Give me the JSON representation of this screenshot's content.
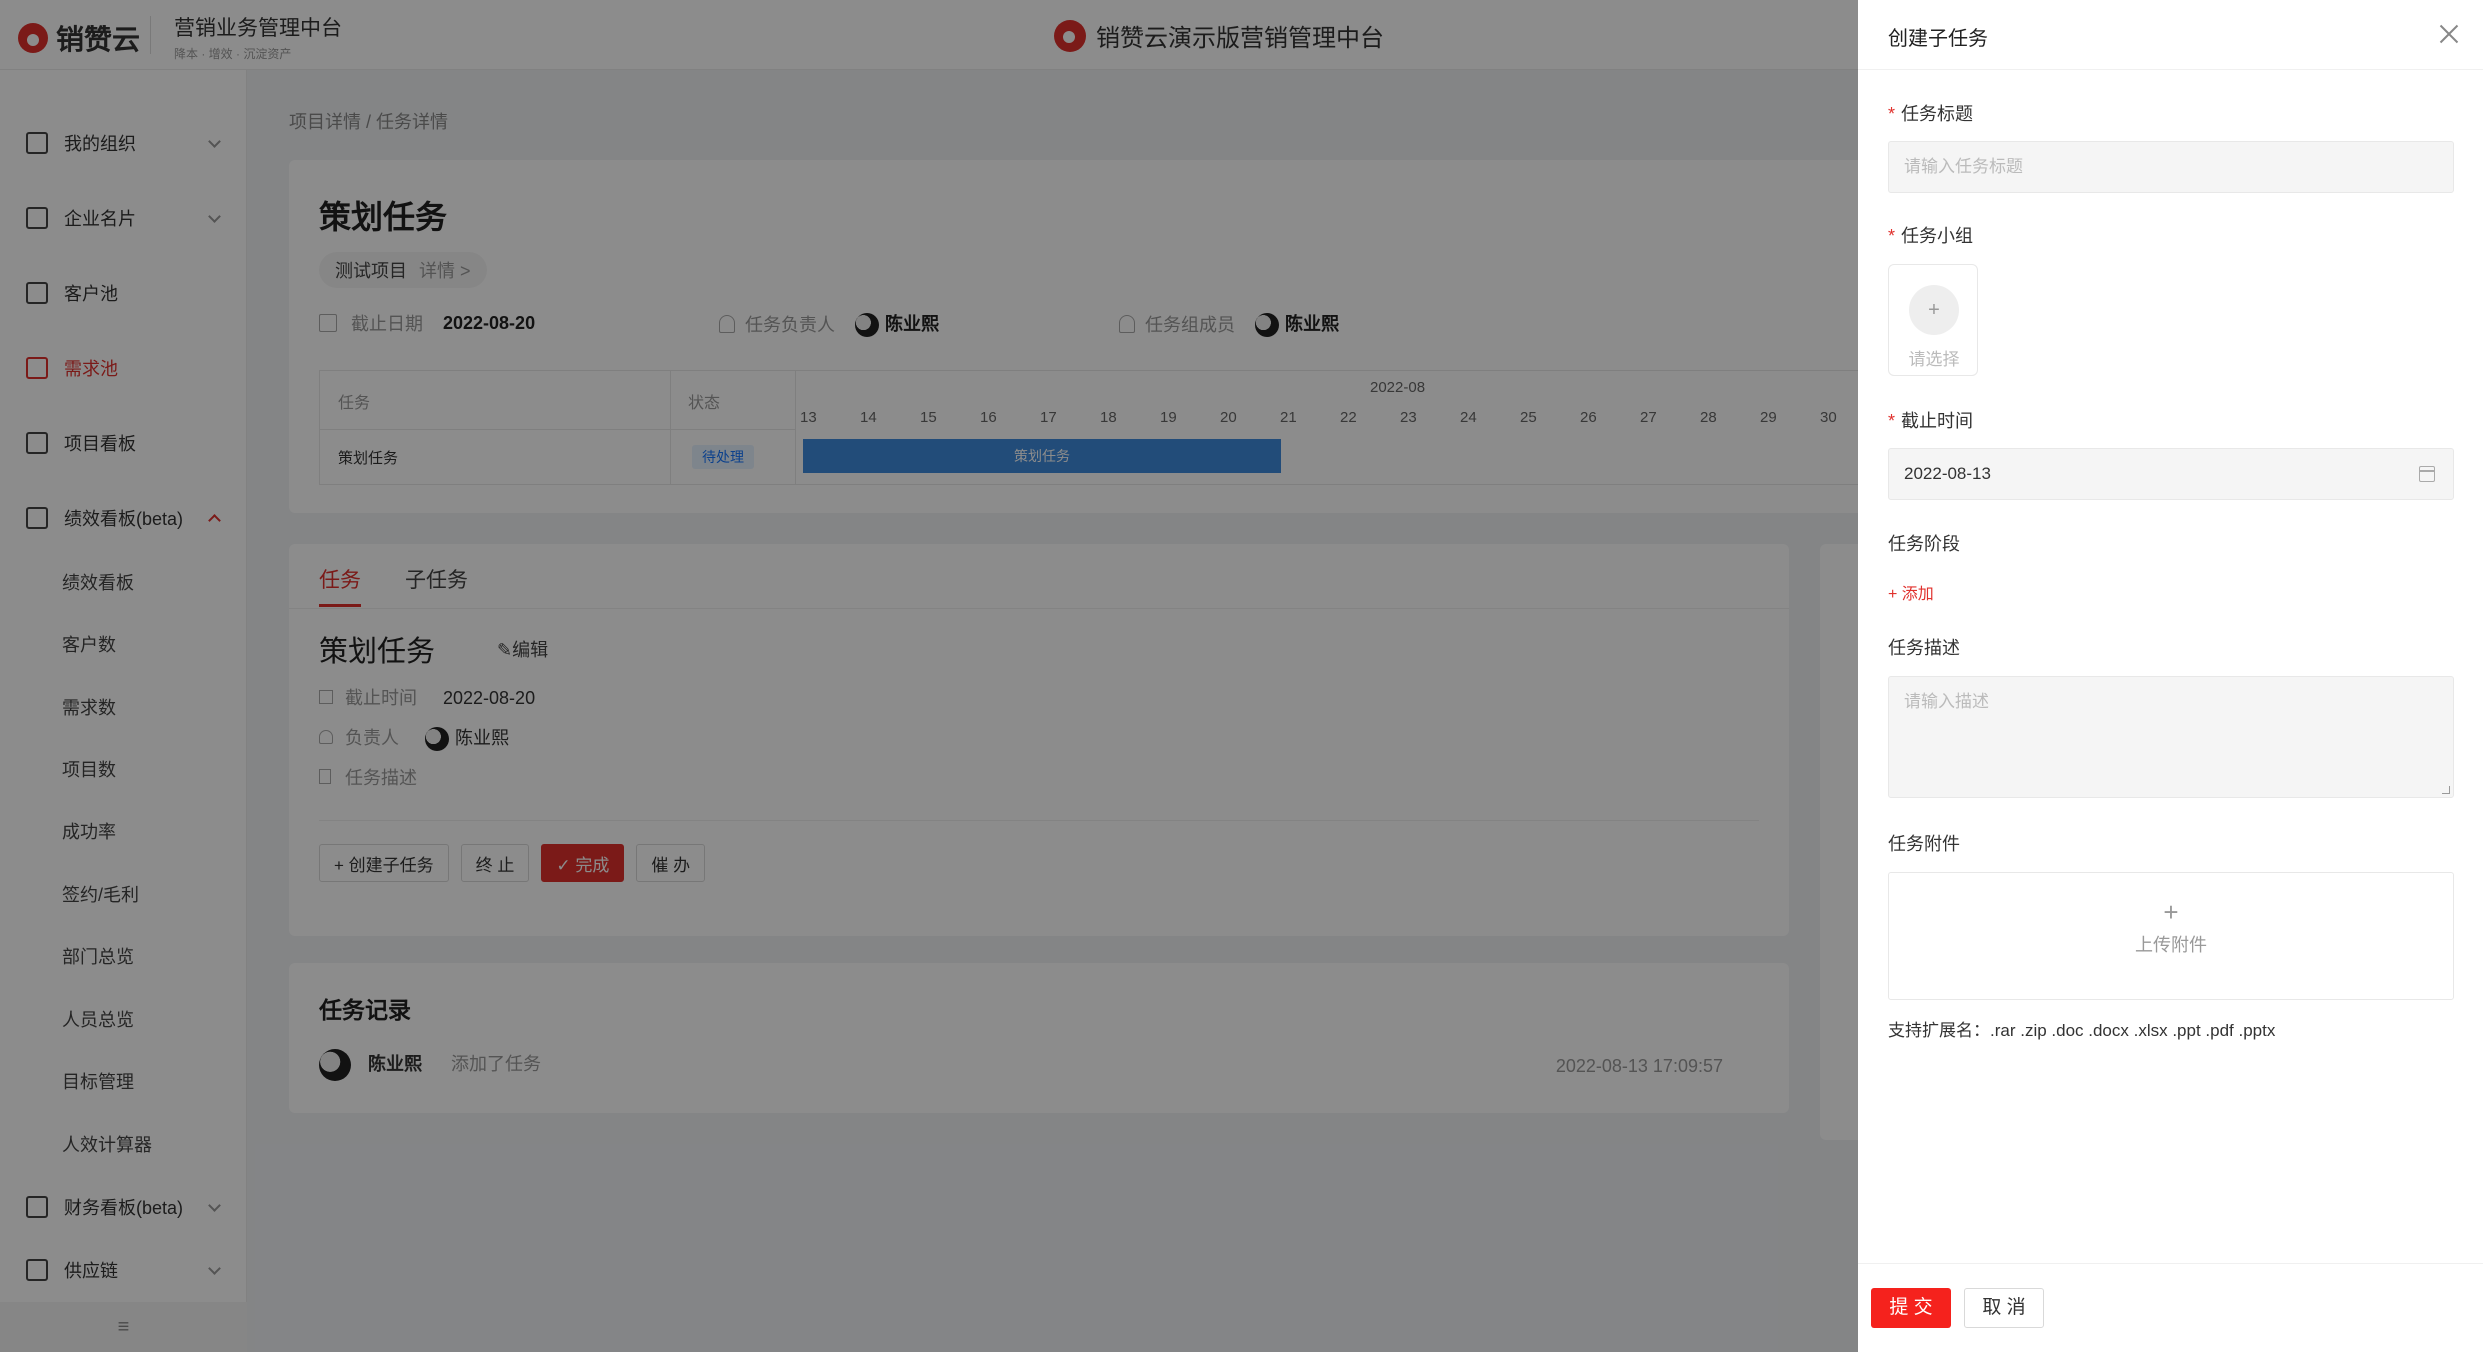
{
  "brand": {
    "logo_text": "销赞云",
    "product": "营销业务管理中台",
    "product_sub": "降本 · 增效 · 沉淀资产",
    "center_title": "销赞云演示版营销管理中台"
  },
  "sidebar": {
    "items": [
      {
        "label": "我的组织"
      },
      {
        "label": "企业名片"
      },
      {
        "label": "客户池"
      },
      {
        "label": "需求池"
      },
      {
        "label": "项目看板"
      },
      {
        "label": "绩效看板(beta)"
      },
      {
        "label": "财务看板(beta)"
      },
      {
        "label": "供应链"
      }
    ],
    "sub_items": [
      "绩效看板",
      "客户数",
      "需求数",
      "项目数",
      "成功率",
      "签约/毛利",
      "部门总览",
      "人员总览",
      "目标管理",
      "人效计算器"
    ],
    "collapse_icon": "≡"
  },
  "breadcrumb": "项目详情  /  任务详情",
  "task_header": {
    "title": "策划任务",
    "project": "测试项目",
    "project_detail": "详情 >",
    "deadline_label": "截止日期",
    "deadline": "2022-08-20",
    "owner_label": "任务负责人",
    "owner": "陈业熙",
    "member_label": "任务组成员",
    "member": "陈业熙"
  },
  "gantt": {
    "col_task": "任务",
    "col_status": "状态",
    "month": "2022-08",
    "days": [
      "13",
      "14",
      "15",
      "16",
      "17",
      "18",
      "19",
      "20",
      "21",
      "22",
      "23",
      "24",
      "25",
      "26",
      "27",
      "28",
      "29",
      "30"
    ],
    "row_task": "策划任务",
    "row_status": "待处理",
    "bar_label": "策划任务"
  },
  "detail": {
    "tab_task": "任务",
    "tab_sub": "子任务",
    "title": "策划任务",
    "edit": "编辑",
    "deadline_label": "截止时间",
    "deadline": "2022-08-20",
    "owner_label": "负责人",
    "owner": "陈业熙",
    "desc_label": "任务描述",
    "btn_create_sub": "+  创建子任务",
    "btn_stop": "终 止",
    "btn_done": "✓  完成",
    "btn_urge": "催 办"
  },
  "records": {
    "title": "任务记录",
    "user": "陈业熙",
    "action": "添加了任务",
    "time": "2022-08-13 17:09:57"
  },
  "drawer": {
    "title": "创建子任务",
    "field_title_label": "任务标题",
    "field_title_placeholder": "请输入任务标题",
    "field_group_label": "任务小组",
    "group_placeholder": "请选择",
    "field_deadline_label": "截止时间",
    "deadline_value": "2022-08-13",
    "field_stage_label": "任务阶段",
    "add_stage": "+ 添加",
    "field_desc_label": "任务描述",
    "desc_placeholder": "请输入描述",
    "field_attach_label": "任务附件",
    "upload_label": "上传附件",
    "ext_hint": "支持扩展名：.rar .zip .doc .docx .xlsx .ppt .pdf .pptx",
    "submit": "提 交",
    "cancel": "取 消"
  },
  "colors": {
    "accent": "#e0312d",
    "submit": "#f5221d",
    "gantt_bar": "#3f8bdc"
  }
}
